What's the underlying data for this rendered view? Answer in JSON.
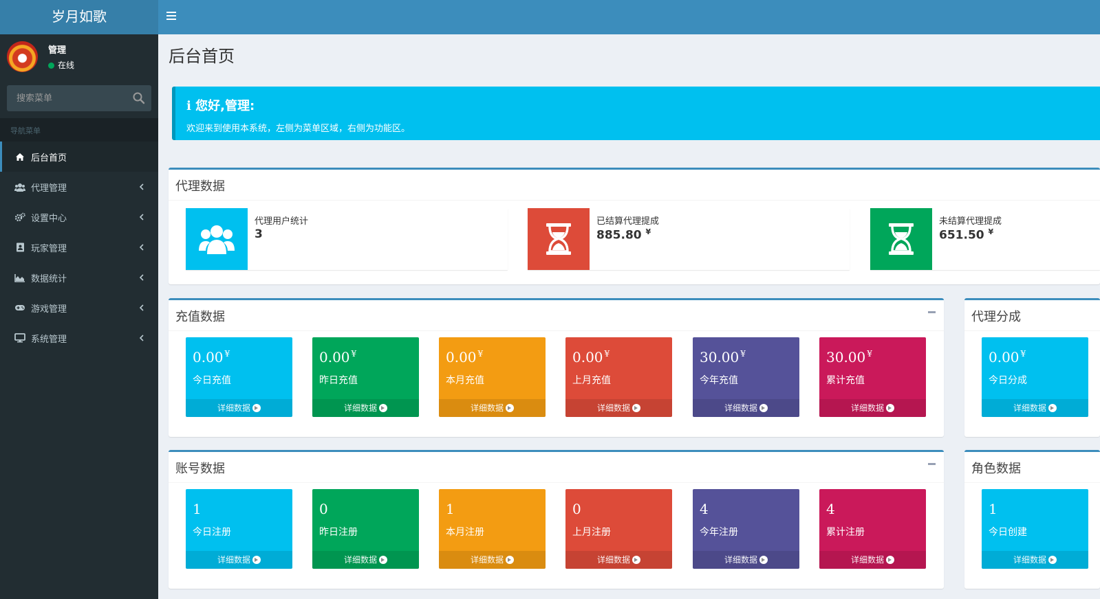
{
  "app": {
    "title": "岁月如歌"
  },
  "user": {
    "name": "管理",
    "status": "在线"
  },
  "search": {
    "placeholder": "搜索菜单"
  },
  "nav": {
    "header": "导航菜单",
    "items": [
      {
        "label": "后台首页",
        "icon": "home-icon"
      },
      {
        "label": "代理管理",
        "icon": "users-icon"
      },
      {
        "label": "设置中心",
        "icon": "cogs-icon"
      },
      {
        "label": "玩家管理",
        "icon": "address-book-icon"
      },
      {
        "label": "数据统计",
        "icon": "area-chart-icon"
      },
      {
        "label": "游戏管理",
        "icon": "gamepad-icon"
      },
      {
        "label": "系统管理",
        "icon": "desktop-icon"
      }
    ]
  },
  "page": {
    "title": "后台首页"
  },
  "callout": {
    "icon": "ℹ",
    "title": "您好,管理:",
    "text": "欢迎来到使用本系统，左侧为菜单区域，右侧为功能区。"
  },
  "agent": {
    "title": "代理数据",
    "boxes": [
      {
        "label": "代理用户统计",
        "value": "3",
        "unit": "",
        "icon": "users-icon",
        "color": "#00c0ef"
      },
      {
        "label": "已结算代理提成",
        "value": "885.80",
        "unit": "¥",
        "icon": "hourglass-icon",
        "color": "#dd4b39"
      },
      {
        "label": "未结算代理提成",
        "value": "651.50",
        "unit": "¥",
        "icon": "hourglass-icon",
        "color": "#00a65a"
      }
    ]
  },
  "recharge": {
    "title": "充值数据",
    "boxes": [
      {
        "value": "0.00",
        "unit": "¥",
        "label": "今日充值",
        "footer": "详细数据"
      },
      {
        "value": "0.00",
        "unit": "¥",
        "label": "昨日充值",
        "footer": "详细数据"
      },
      {
        "value": "0.00",
        "unit": "¥",
        "label": "本月充值",
        "footer": "详细数据"
      },
      {
        "value": "0.00",
        "unit": "¥",
        "label": "上月充值",
        "footer": "详细数据"
      },
      {
        "value": "30.00",
        "unit": "¥",
        "label": "今年充值",
        "footer": "详细数据"
      },
      {
        "value": "30.00",
        "unit": "¥",
        "label": "累计充值",
        "footer": "详细数据"
      }
    ]
  },
  "commission": {
    "title": "代理分成",
    "boxes": [
      {
        "value": "0.00",
        "unit": "¥",
        "label": "今日分成",
        "footer": "详细数据"
      }
    ]
  },
  "accounts": {
    "title": "账号数据",
    "boxes": [
      {
        "value": "1",
        "label": "今日注册",
        "footer": "详细数据"
      },
      {
        "value": "0",
        "label": "昨日注册",
        "footer": "详细数据"
      },
      {
        "value": "1",
        "label": "本月注册",
        "footer": "详细数据"
      },
      {
        "value": "0",
        "label": "上月注册",
        "footer": "详细数据"
      },
      {
        "value": "4",
        "label": "今年注册",
        "footer": "详细数据"
      },
      {
        "value": "4",
        "label": "累计注册",
        "footer": "详细数据"
      }
    ]
  },
  "roles": {
    "title": "角色数据",
    "boxes": [
      {
        "value": "1",
        "label": "今日创建",
        "footer": "详细数据"
      }
    ]
  },
  "colors": {
    "aqua": "#00c0ef",
    "green": "#00a65a",
    "yellow": "#f39c12",
    "red": "#dd4b39",
    "purple": "#555299",
    "maroon": "#ca195a"
  }
}
